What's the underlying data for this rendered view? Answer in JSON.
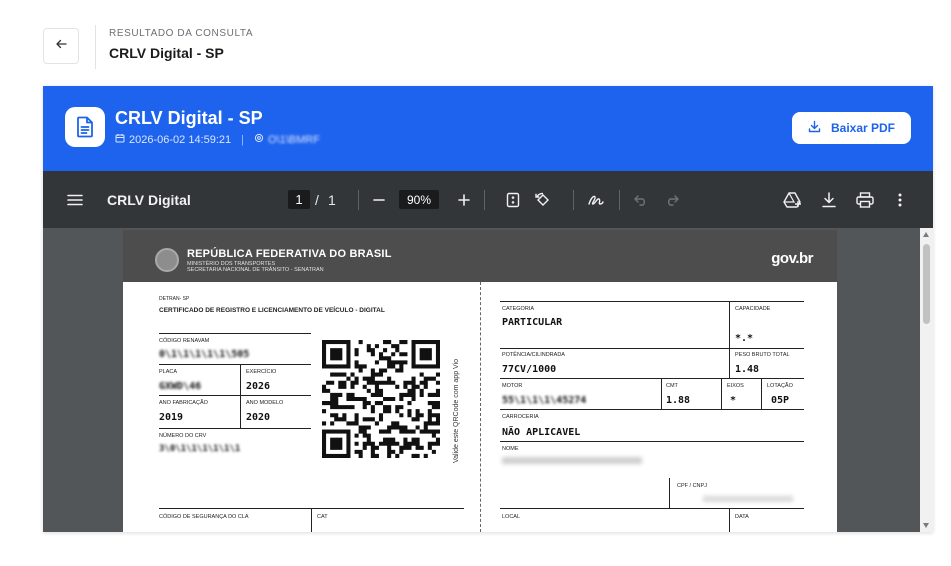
{
  "header": {
    "kicker": "RESULTADO DA CONSULTA",
    "title": "CRLV Digital - SP"
  },
  "banner": {
    "title": "CRLV Digital - SP",
    "datetime": "2026-06-02 14:59:21",
    "plate_masked": "O\\1\\BMRF",
    "download_label": "Baixar PDF",
    "color": "#1d63ed"
  },
  "viewer": {
    "doc_title": "CRLV Digital",
    "page_current": "1",
    "page_sep": "/",
    "page_total": "1",
    "zoom": "90%",
    "toolbar_color": "#323639"
  },
  "document": {
    "header_title": "REPÚBLICA FEDERATIVA DO BRASIL",
    "header_sub1": "MINISTÉRIO DOS TRANSPORTES",
    "header_sub2": "SECRETARIA NACIONAL DE TRÂNSITO - SENATRAN",
    "brand": "gov.br",
    "issuer": "DETRAN- SP",
    "doc_name": "CERTIFICADO DE REGISTRO E LICENCIAMENTO DE VEÍCULO - DIGITAL",
    "renavam_label": "CÓDIGO RENAVAM",
    "renavam_value": "0\\1\\1\\1\\1\\1\\505",
    "placa_label": "PLACA",
    "placa_value": "GXWD\\46",
    "exercicio_label": "EXERCÍCIO",
    "exercicio_value": "2026",
    "ano_fab_label": "ANO FABRICAÇÃO",
    "ano_fab_value": "2019",
    "ano_modelo_label": "ANO MODELO",
    "ano_modelo_value": "2020",
    "crv_label": "NÚMERO DO CRV",
    "crv_value": "3\\0\\1\\1\\1\\1\\1\\1",
    "qr_caption": "Valide este QRCode com app Vio",
    "seg_cla_label": "CÓDIGO DE SEGURANÇA DO CLA",
    "cat_label": "CAT",
    "categoria_label": "CATEGORIA",
    "categoria_value": "PARTICULAR",
    "capacidade_label": "CAPACIDADE",
    "capacidade_value": "*.*",
    "potencia_label": "POTÊNCIA/CILINDRADA",
    "potencia_value": "77CV/1000",
    "peso_label": "PESO BRUTO TOTAL",
    "peso_value": "1.48",
    "motor_label": "MOTOR",
    "motor_value": "55\\1\\1\\1\\45274",
    "cmt_label": "CMT",
    "cmt_value": "1.88",
    "eixos_label": "EIXOS",
    "eixos_value": "*",
    "lotacao_label": "LOTAÇÃO",
    "lotacao_value": "05P",
    "carroceria_label": "CARROCERIA",
    "carroceria_value": "NÃO APLICAVEL",
    "nome_label": "NOME",
    "cpf_label": "CPF / CNPJ",
    "local_label": "LOCAL",
    "data_label": "DATA"
  },
  "icons": {
    "back": "arrow-left-icon",
    "doc": "document-icon",
    "download": "download-icon",
    "menu": "hamburger-icon",
    "fit": "fit-page-icon",
    "rotate": "rotate-icon",
    "annotate": "pen-icon",
    "undo": "undo-icon",
    "redo": "redo-icon",
    "drive": "drive-add-icon",
    "print": "print-icon",
    "more": "more-vert-icon"
  }
}
